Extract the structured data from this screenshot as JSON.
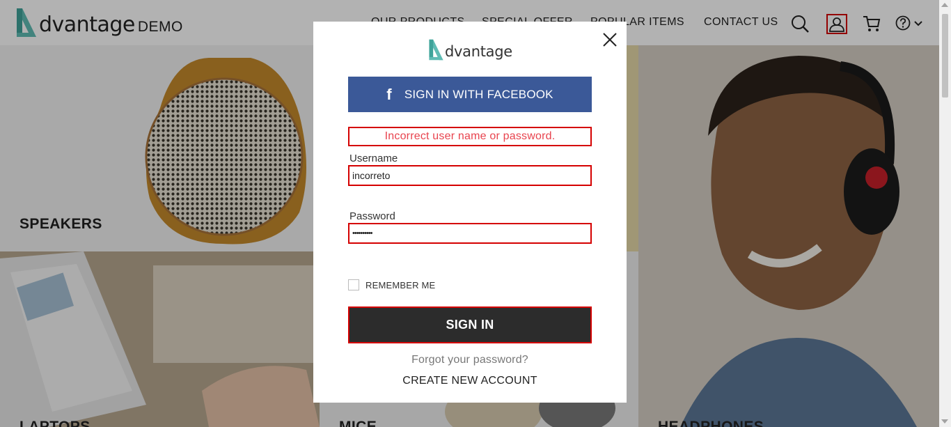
{
  "header": {
    "brand": "dvantage",
    "brand_suffix": "DEMO",
    "nav": [
      "OUR PRODUCTS",
      "SPECIAL OFFER",
      "POPULAR ITEMS",
      "CONTACT US"
    ],
    "icons": [
      "search-icon",
      "user-icon",
      "cart-icon",
      "help-icon",
      "chevron-down-icon"
    ]
  },
  "tiles": {
    "speakers": "SPEAKERS",
    "laptops": "LAPTOPS",
    "mice": "MICE",
    "headphones": "HEADPHONES"
  },
  "login": {
    "brand": "dvantage",
    "facebook_label": "SIGN IN WITH FACEBOOK",
    "error": "Incorrect user name or password.",
    "username_label": "Username",
    "username_value": "incorreto",
    "password_label": "Password",
    "password_value": "••••••••••",
    "remember_label": "REMEMBER ME",
    "signin_label": "SIGN IN",
    "forgot_label": "Forgot your password?",
    "create_label": "CREATE NEW ACCOUNT"
  },
  "colors": {
    "accent": "#5fbcb4",
    "facebook": "#3b5998",
    "error": "#e8434e",
    "highlight_border": "#d50000",
    "button_dark": "#2c2c2c"
  }
}
